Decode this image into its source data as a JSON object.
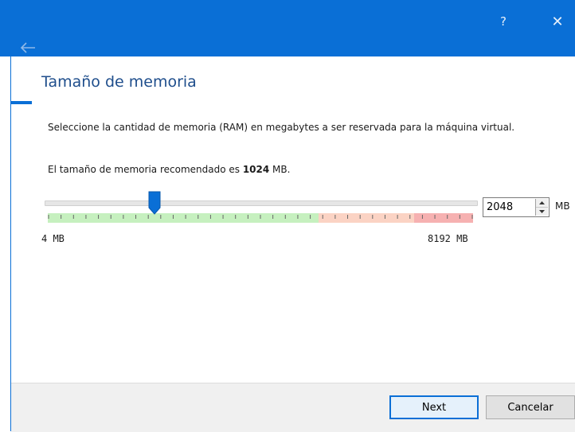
{
  "window": {
    "help_label": "?",
    "close_label": "✕",
    "titlebar_color": "#0a6fd6"
  },
  "page": {
    "title": "Tamaño de memoria",
    "description": "Seleccione la cantidad de memoria (RAM) en megabytes a ser reservada para la máquina virtual.",
    "recommend_prefix": "El tamaño de memoria recomendado es ",
    "recommend_value": "1024",
    "recommend_suffix": " MB."
  },
  "memory": {
    "min_label": "4 MB",
    "max_label": "8192 MB",
    "min_value": 4,
    "max_value": 8192,
    "current_value": "2048",
    "unit": "MB",
    "slider_fraction": 0.25
  },
  "buttons": {
    "next": "Next",
    "cancel": "Cancelar"
  },
  "icons": {
    "back": "arrow-left-icon",
    "spin_up": "triangle-up-icon",
    "spin_down": "triangle-down-icon"
  }
}
